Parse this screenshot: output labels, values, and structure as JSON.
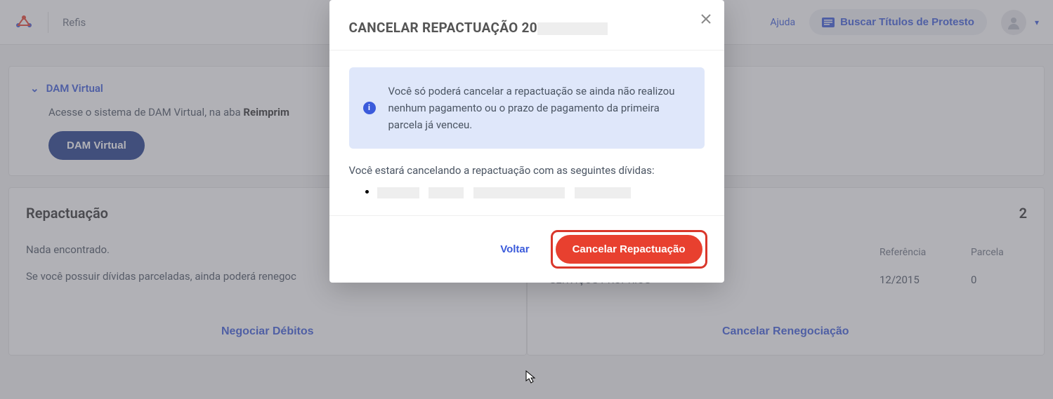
{
  "topbar": {
    "brand": "Refis",
    "help": "Ajuda",
    "search_label": "Buscar Títulos de Protesto"
  },
  "accordion": {
    "title": "DAM Virtual",
    "body_prefix": "Acesse o sistema de DAM Virtual, na aba ",
    "body_bold": "Reimprim",
    "button": "DAM Virtual"
  },
  "left_card": {
    "title": "Repactuação",
    "line1": "Nada encontrado.",
    "line2": "Se você possuir dívidas parceladas, ainda poderá renegoc",
    "footer_btn": "Negociar Débitos"
  },
  "right_card": {
    "title_suffix": "2",
    "col_ref": "Referência",
    "col_par": "Parcela",
    "row_desc": "- SERVIÇOS PRÓPRIOS",
    "row_ref": "12/2015",
    "row_par": "0",
    "footer_btn": "Cancelar Renegociação"
  },
  "modal": {
    "title_prefix": "CANCELAR REPACTUAÇÃO 20",
    "info_text": "Você só poderá cancelar a repactuação se ainda não realizou nenhum pagamento ou o prazo de pagamento da primeira parcela já venceu.",
    "body_text": "Você estará cancelando a repactuação com as seguintes dívidas:",
    "back_label": "Voltar",
    "confirm_label": "Cancelar Repactuação"
  }
}
